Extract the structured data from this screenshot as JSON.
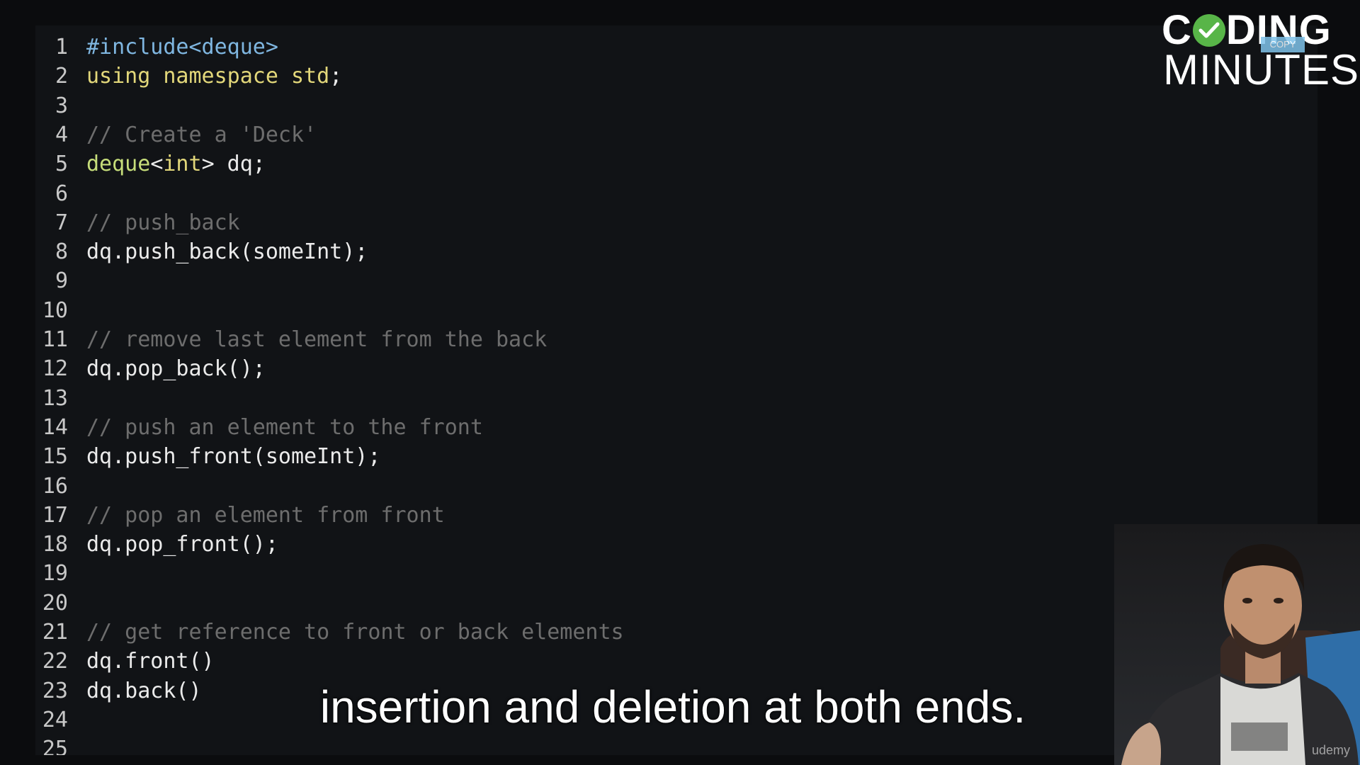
{
  "code": {
    "lines": [
      {
        "n": "1",
        "segments": [
          {
            "t": "#include<deque>",
            "k": "pp"
          }
        ]
      },
      {
        "n": "2",
        "segments": [
          {
            "t": "using namespace std",
            "k": "kw"
          },
          {
            "t": ";",
            "k": "df"
          }
        ]
      },
      {
        "n": "3",
        "segments": []
      },
      {
        "n": "4",
        "segments": [
          {
            "t": "// Create a 'Deck'",
            "k": "cm"
          }
        ]
      },
      {
        "n": "5",
        "segments": [
          {
            "t": "deque",
            "k": "ty"
          },
          {
            "t": "<",
            "k": "df"
          },
          {
            "t": "int",
            "k": "kw"
          },
          {
            "t": "> dq;",
            "k": "df"
          }
        ]
      },
      {
        "n": "6",
        "segments": []
      },
      {
        "n": "7",
        "segments": [
          {
            "t": "// push_back",
            "k": "cm"
          }
        ]
      },
      {
        "n": "8",
        "segments": [
          {
            "t": "dq.push_back(someInt);",
            "k": "df"
          }
        ]
      },
      {
        "n": "9",
        "segments": []
      },
      {
        "n": "10",
        "segments": []
      },
      {
        "n": "11",
        "segments": [
          {
            "t": "// remove last element from the back",
            "k": "cm"
          }
        ]
      },
      {
        "n": "12",
        "segments": [
          {
            "t": "dq.pop_back();",
            "k": "df"
          }
        ]
      },
      {
        "n": "13",
        "segments": []
      },
      {
        "n": "14",
        "segments": [
          {
            "t": "// push an element to the front",
            "k": "cm"
          }
        ]
      },
      {
        "n": "15",
        "segments": [
          {
            "t": "dq.push_front(someInt);",
            "k": "df"
          }
        ]
      },
      {
        "n": "16",
        "segments": []
      },
      {
        "n": "17",
        "segments": [
          {
            "t": "// pop an element from front",
            "k": "cm"
          }
        ]
      },
      {
        "n": "18",
        "segments": [
          {
            "t": "dq.pop_front();",
            "k": "df"
          }
        ]
      },
      {
        "n": "19",
        "segments": []
      },
      {
        "n": "20",
        "segments": []
      },
      {
        "n": "21",
        "segments": [
          {
            "t": "// get reference to front or back elements",
            "k": "cm"
          }
        ]
      },
      {
        "n": "22",
        "segments": [
          {
            "t": "dq.front()",
            "k": "df"
          }
        ]
      },
      {
        "n": "23",
        "segments": [
          {
            "t": "dq.back()",
            "k": "df"
          }
        ]
      },
      {
        "n": "24",
        "segments": []
      },
      {
        "n": "25",
        "segments": []
      }
    ]
  },
  "logo": {
    "line1_a": "C",
    "line1_b": "DING",
    "line2": "MINUTES",
    "copy_tag": "COPY",
    "check_icon": "check-circle-icon",
    "check_color": "#58b548"
  },
  "watermark": "udemy",
  "subtitle": "insertion and deletion at both ends.",
  "colors": {
    "preprocessor": "#7fb6e0",
    "keyword": "#e2d77a",
    "comment": "#6d6d6d",
    "type": "#c6dd7a",
    "default": "#ebebeb",
    "background": "#111316"
  }
}
